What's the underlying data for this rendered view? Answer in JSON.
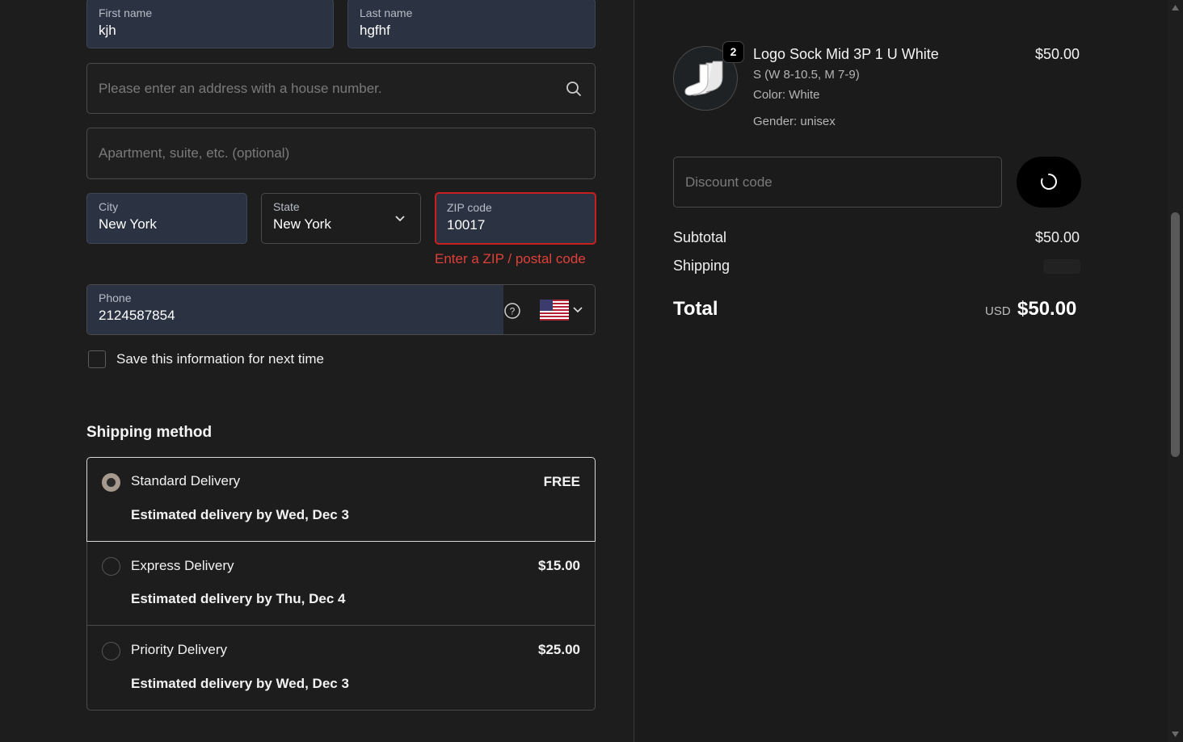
{
  "form": {
    "first_name": {
      "label": "First name",
      "value": "kjh"
    },
    "last_name": {
      "label": "Last name",
      "value": "hgfhf"
    },
    "address": {
      "placeholder": "Please enter an address with a house number."
    },
    "apartment": {
      "placeholder": "Apartment, suite, etc. (optional)"
    },
    "city": {
      "label": "City",
      "value": "New York"
    },
    "state": {
      "label": "State",
      "value": "New York"
    },
    "zip": {
      "label": "ZIP code",
      "value": "10017",
      "error": "Enter a ZIP / postal code"
    },
    "phone": {
      "label": "Phone",
      "value": "2124587854",
      "country_flag": "us-flag-icon"
    },
    "save_info_label": "Save this information for next time"
  },
  "shipping": {
    "title": "Shipping method",
    "options": [
      {
        "name": "Standard Delivery",
        "price": "FREE",
        "estimate": "Estimated delivery by Wed, Dec 3",
        "selected": true
      },
      {
        "name": "Express Delivery",
        "price": "$15.00",
        "estimate": "Estimated delivery by Thu, Dec 4",
        "selected": false
      },
      {
        "name": "Priority Delivery",
        "price": "$25.00",
        "estimate": "Estimated delivery by Wed, Dec 3",
        "selected": false
      }
    ]
  },
  "summary": {
    "item": {
      "quantity": "2",
      "name": "Logo Sock Mid 3P 1 U White",
      "price": "$50.00",
      "size": "S (W 8-10.5, M 7-9)",
      "color": "Color: White",
      "gender": "Gender: unisex"
    },
    "discount_placeholder": "Discount code",
    "subtotal_label": "Subtotal",
    "subtotal_value": "$50.00",
    "shipping_label": "Shipping",
    "total_label": "Total",
    "currency": "USD",
    "total_value": "$50.00"
  },
  "colors": {
    "error": "#c8201f",
    "filled_field": "#2b3342",
    "radio_selected": "#a69a8f"
  }
}
